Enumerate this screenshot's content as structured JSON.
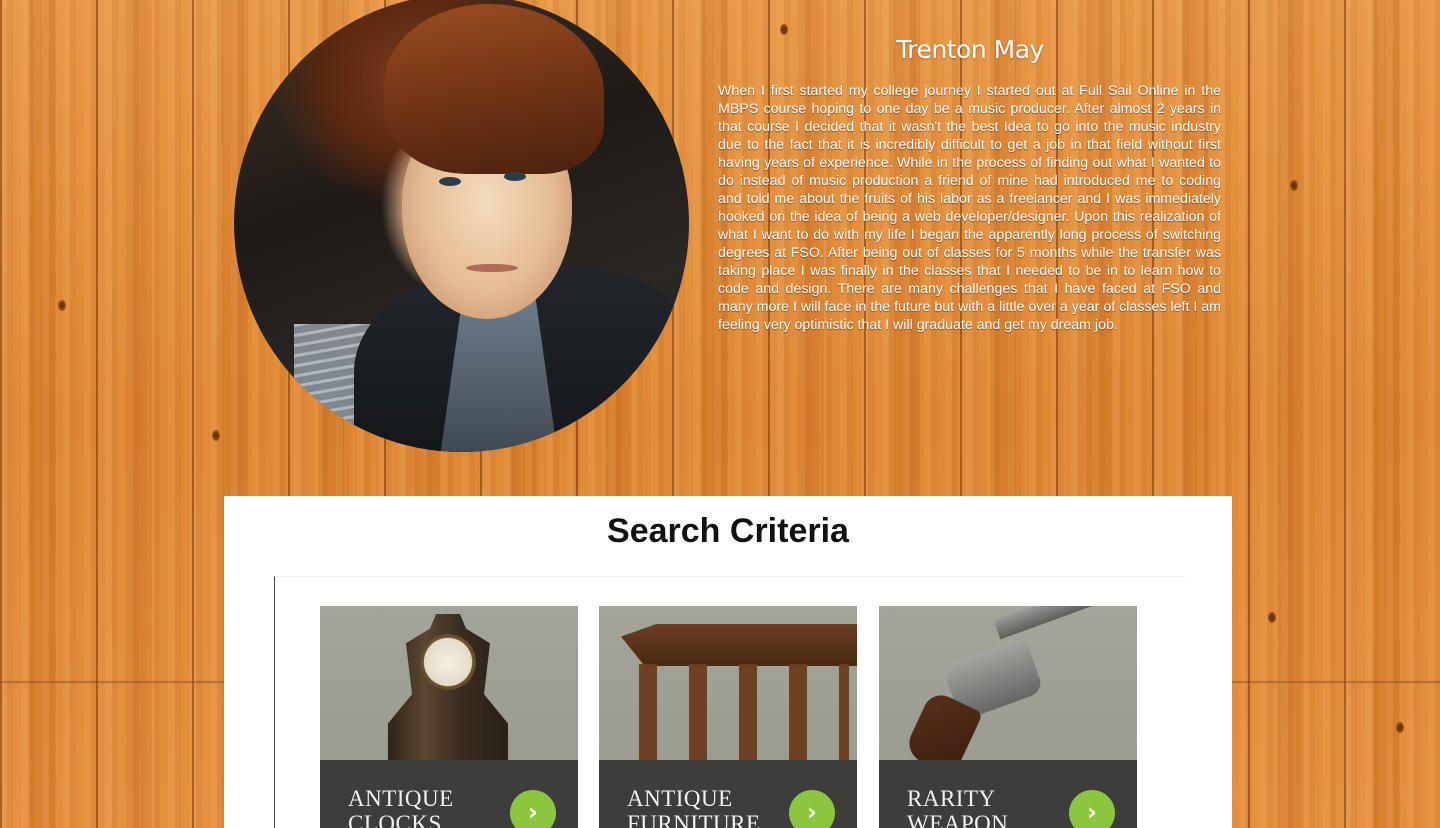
{
  "profile": {
    "name": "Trenton May",
    "photo_alt": "profile-photo",
    "bio": "When I first started my college journey I started out at Full Sail Online in the MBPS course hoping to one day be a music producer. After almost 2 years in that course I decided that it wasn't the best Idea to go into the music industry due to the fact that it is incredibly difficult to get a job in that field without first having years of experience. While in the process of finding out what I wanted to do instead of music production a friend of mine had introduced me to coding and told me about the fruits of his labor as a freelancer and I was immediately hooked on the idea of being a web developer/designer. Upon this realization of what I want to do with my life I began the apparently long process of switching degrees at FSO. After being out of classes for 5 months while the transfer was taking place I was finally in the classes that I needed to be in to learn how to code and design. There are many challenges that I have faced at FSO and many more I will face in the future but with a little over a year of classes left I am feeling very optimistic that I will graduate and get my dream job."
  },
  "search": {
    "title": "Search Criteria",
    "categories": [
      {
        "label": "ANTIQUE\nCLOCKS",
        "arrow": "›",
        "image": "antique-clock"
      },
      {
        "label": "ANTIQUE\nFURNITURE",
        "arrow": "›",
        "image": "antique-table"
      },
      {
        "label": "RARITY\nWEAPON",
        "arrow": "›",
        "image": "revolver"
      }
    ]
  },
  "colors": {
    "background_wood": "#e08a3a",
    "panel": "#ffffff",
    "card_footer": "#3d3d3b",
    "card_image_bg": "#a3a59b",
    "arrow_button": "#8cc63f",
    "text_light": "#ffffff"
  }
}
